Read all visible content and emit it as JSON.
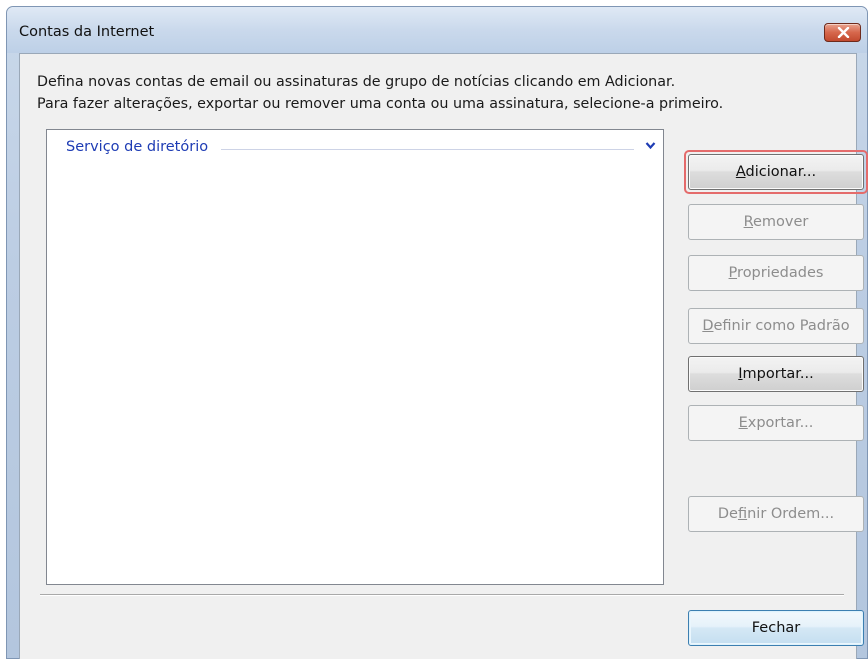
{
  "window": {
    "title": "Contas da Internet"
  },
  "intro": {
    "line1": "Defina novas contas de email ou assinaturas de grupo de notícias clicando em Adicionar.",
    "line2": "Para fazer alterações, exportar ou remover uma conta ou uma assinatura, selecione-a primeiro."
  },
  "accounts_list": {
    "group_label": "Serviço de diretório",
    "group_state": "expanded"
  },
  "buttons": {
    "add": {
      "pre": "",
      "key": "A",
      "post": "dicionar...",
      "enabled": true
    },
    "remove": {
      "pre": "",
      "key": "R",
      "post": "emover",
      "enabled": false
    },
    "properties": {
      "pre": "",
      "key": "P",
      "post": "ropriedades",
      "enabled": false
    },
    "set_default": {
      "pre": "",
      "key": "D",
      "post": "efinir como Padrão",
      "enabled": false
    },
    "import": {
      "pre": "",
      "key": "I",
      "post": "mportar...",
      "enabled": true
    },
    "export": {
      "pre": "",
      "key": "E",
      "post": "xportar...",
      "enabled": false
    },
    "set_order": {
      "pre": "De",
      "key": "f",
      "post": "inir Ordem...",
      "enabled": false
    },
    "close": {
      "label": "Fechar",
      "enabled": true
    }
  },
  "colors": {
    "group_header": "#1e3cb4",
    "highlight": "#e46b6b",
    "close_button": "#c24a2f"
  },
  "icons": {
    "close": "close-icon",
    "chevron": "chevron-down-icon"
  }
}
